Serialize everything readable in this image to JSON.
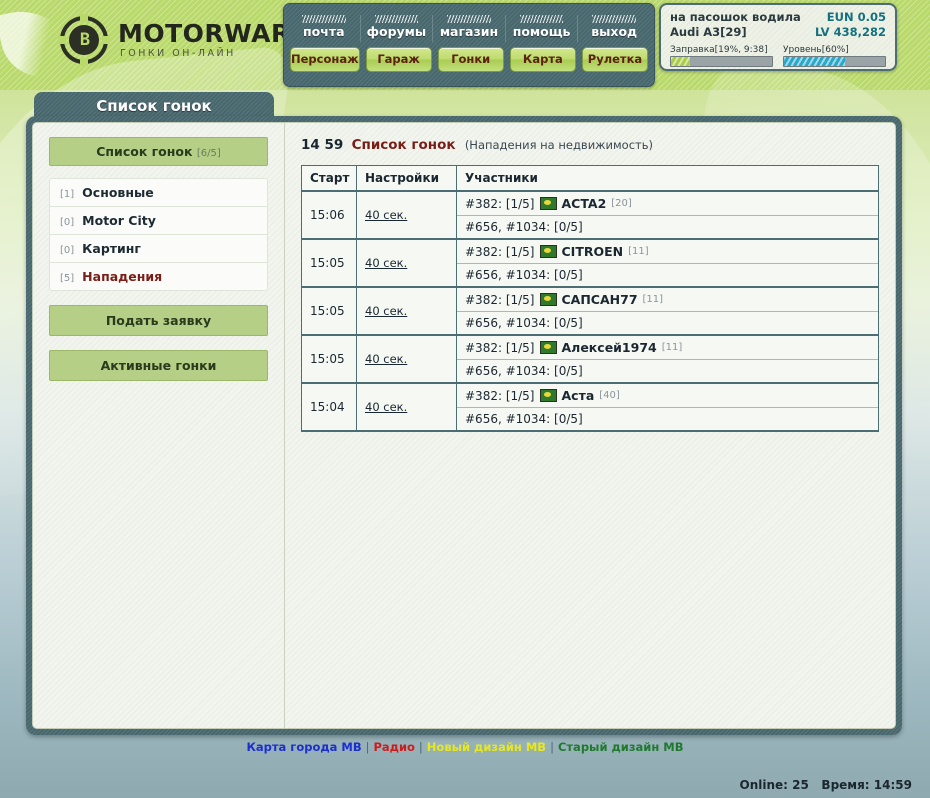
{
  "brand": {
    "logo_glyph": "B",
    "title": "MOTORWARS.RU",
    "subtitle": "ГОНКИ ОН-ЛАЙН"
  },
  "topnav": {
    "links": [
      {
        "label": "почта",
        "icon": "hatch-icon"
      },
      {
        "label": "форумы",
        "icon": "hatch-icon"
      },
      {
        "label": "магазин",
        "icon": "hatch-icon"
      },
      {
        "label": "помощь",
        "icon": "hatch-icon"
      },
      {
        "label": "выход",
        "icon": "hatch-icon"
      }
    ],
    "buttons": [
      {
        "label": "Персонаж"
      },
      {
        "label": "Гараж"
      },
      {
        "label": "Гонки"
      },
      {
        "label": "Карта"
      },
      {
        "label": "Рулетка"
      }
    ]
  },
  "status": {
    "player_name": "на пасошок водила",
    "car": "Audi A3[29]",
    "currency_label": "EUN",
    "currency_value": "0.05",
    "level_label": "LV",
    "level_value": "438,282",
    "fuel": {
      "label": "Заправка[19%, 9:38]",
      "percent": 19,
      "color": "#aacc46"
    },
    "level_bar": {
      "label": "Уровень[60%]",
      "percent": 60,
      "color": "#2ba8c9"
    }
  },
  "window": {
    "tab_title": "Список гонок"
  },
  "sidebar": {
    "header": {
      "label": "Список гонок",
      "count": "[6/5]"
    },
    "items": [
      {
        "badge": "[1]",
        "label": "Основные",
        "active": false
      },
      {
        "badge": "[0]",
        "label": "Motor City",
        "active": false
      },
      {
        "badge": "[0]",
        "label": "Картинг",
        "active": false
      },
      {
        "badge": "[5]",
        "label": "Нападения",
        "active": true
      }
    ],
    "buttons": [
      {
        "label": "Подать заявку"
      },
      {
        "label": "Активные гонки"
      }
    ]
  },
  "content": {
    "clock": "14 59",
    "title": "Список гонок",
    "note": "(Нападения на недвижимость)",
    "columns": [
      "Старт",
      "Настройки",
      "Участники"
    ],
    "rows": [
      {
        "start": "15:06",
        "settings": "40 сек.",
        "participants": [
          {
            "slot": "#382: [1/5]",
            "flag": "flag-icon",
            "name": "ACTA2",
            "level": "[20]"
          },
          {
            "slot": "#656, #1034: [0/5]",
            "flag": null,
            "name": "",
            "level": ""
          }
        ]
      },
      {
        "start": "15:05",
        "settings": "40 сек.",
        "participants": [
          {
            "slot": "#382: [1/5]",
            "flag": "flag-icon",
            "name": "CITROEN",
            "level": "[11]"
          },
          {
            "slot": "#656, #1034: [0/5]",
            "flag": null,
            "name": "",
            "level": ""
          }
        ]
      },
      {
        "start": "15:05",
        "settings": "40 сек.",
        "participants": [
          {
            "slot": "#382: [1/5]",
            "flag": "flag-icon",
            "name": "САПСАН77",
            "level": "[11]"
          },
          {
            "slot": "#656, #1034: [0/5]",
            "flag": null,
            "name": "",
            "level": ""
          }
        ]
      },
      {
        "start": "15:05",
        "settings": "40 сек.",
        "participants": [
          {
            "slot": "#382: [1/5]",
            "flag": "flag-icon",
            "name": "Алексей1974",
            "level": "[11]"
          },
          {
            "slot": "#656, #1034: [0/5]",
            "flag": null,
            "name": "",
            "level": ""
          }
        ]
      },
      {
        "start": "15:04",
        "settings": "40 сек.",
        "participants": [
          {
            "slot": "#382: [1/5]",
            "flag": "flag-icon",
            "name": "Аста",
            "level": "[40]"
          },
          {
            "slot": "#656, #1034: [0/5]",
            "flag": null,
            "name": "",
            "level": ""
          }
        ]
      }
    ]
  },
  "footer": {
    "links": [
      {
        "label": "Карта города МВ",
        "color": "#1b2fd0"
      },
      {
        "label": "Радио",
        "color": "#d01b1b"
      },
      {
        "label": "Новый дизайн МВ",
        "color": "#e8e81b"
      },
      {
        "label": "Старый дизайн МВ",
        "color": "#1f7a2e"
      }
    ],
    "separator": "|",
    "online_label": "Online:",
    "online_value": "25",
    "time_label": "Время:",
    "time_value": "14:59"
  }
}
